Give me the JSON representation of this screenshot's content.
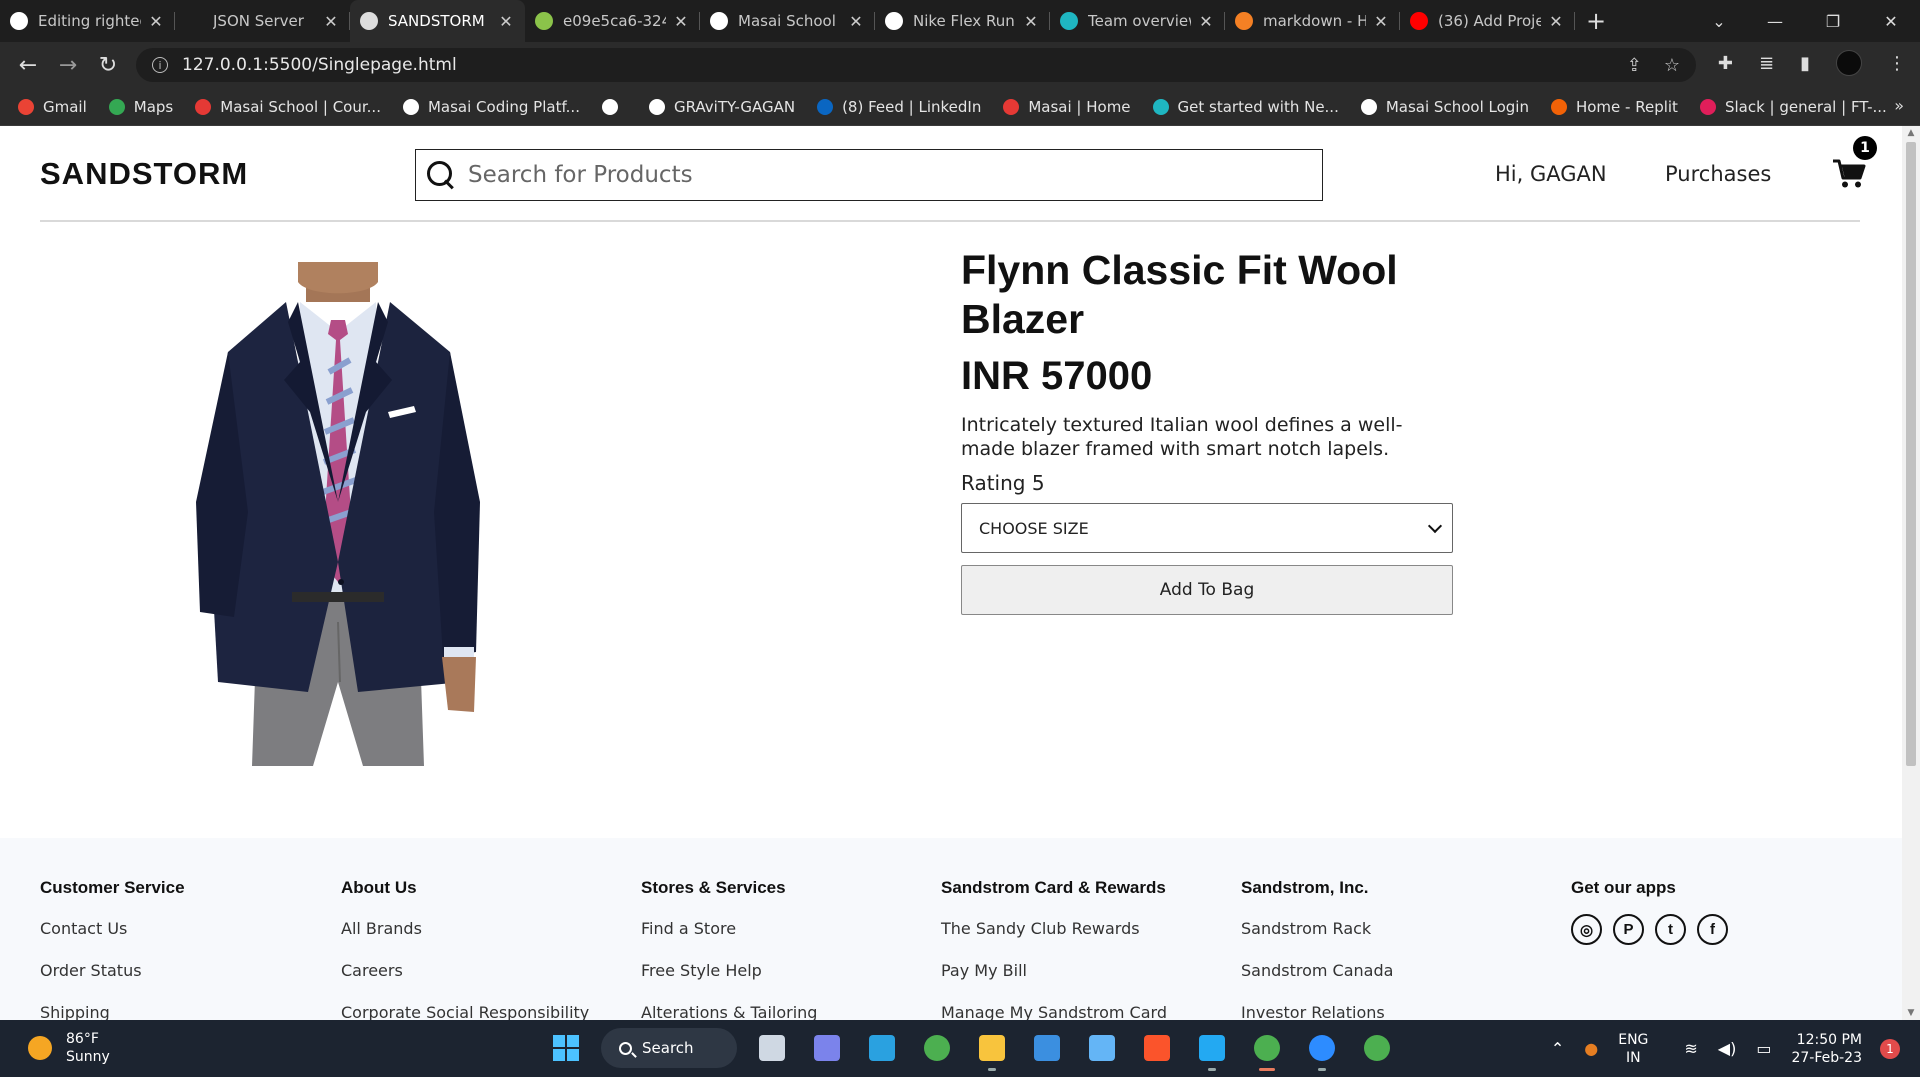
{
  "browser": {
    "tabs": [
      {
        "title": "Editing righted",
        "favicon": "github-icon",
        "fav_color": "#ffffff",
        "active": false
      },
      {
        "title": "JSON Server",
        "favicon": "blank-icon",
        "fav_color": "#1e1e1e",
        "active": false
      },
      {
        "title": "SANDSTORM",
        "favicon": "sandstorm-icon",
        "fav_color": "#dddddd",
        "active": true
      },
      {
        "title": "e09e5ca6-324",
        "favicon": "leaf-icon",
        "fav_color": "#8bc34a",
        "active": false
      },
      {
        "title": "Masai School |",
        "favicon": "globe-icon",
        "fav_color": "#ffffff",
        "active": false
      },
      {
        "title": "Nike Flex Runn",
        "favicon": "notion-icon",
        "fav_color": "#ffffff",
        "active": false
      },
      {
        "title": "Team overview",
        "favicon": "diamond-icon",
        "fav_color": "#1fb6c1",
        "active": false
      },
      {
        "title": "markdown - H",
        "favicon": "stack-icon",
        "fav_color": "#f48024",
        "active": false
      },
      {
        "title": "(36) Add Proje",
        "favicon": "youtube-icon",
        "fav_color": "#ff0000",
        "active": false
      }
    ],
    "new_tab": "+",
    "url": "127.0.0.1:5500/Singlepage.html",
    "bookmarks": [
      {
        "label": "Gmail",
        "icon": "gmail-icon",
        "color": "#ea4335"
      },
      {
        "label": "Maps",
        "icon": "maps-icon",
        "color": "#34a853"
      },
      {
        "label": "Masai School | Cour...",
        "icon": "masai-icon",
        "color": "#e53935"
      },
      {
        "label": "Masai Coding Platf...",
        "icon": "masai-m-icon",
        "color": "#ffffff"
      },
      {
        "label": "",
        "icon": "globe-icon",
        "color": "#ffffff"
      },
      {
        "label": "GRAviTY-GAGAN",
        "icon": "github-icon",
        "color": "#ffffff"
      },
      {
        "label": "(8) Feed | LinkedIn",
        "icon": "linkedin-icon",
        "color": "#0a66c2"
      },
      {
        "label": "Masai | Home",
        "icon": "masai-icon",
        "color": "#e53935"
      },
      {
        "label": "Get started with Ne...",
        "icon": "diamond-icon",
        "color": "#1fb6c1"
      },
      {
        "label": "Masai School Login",
        "icon": "masai-m-icon",
        "color": "#ffffff"
      },
      {
        "label": "Home - Replit",
        "icon": "replit-icon",
        "color": "#f26207"
      },
      {
        "label": "Slack | general | FT-...",
        "icon": "slack-icon",
        "color": "#e01e5a"
      }
    ],
    "bookmarks_more": "»"
  },
  "site": {
    "logo": "SANDSTORM",
    "search_placeholder": "Search for Products",
    "greeting": "Hi, GAGAN",
    "purchases": "Purchases",
    "cart_count": "1"
  },
  "product": {
    "title": "Flynn Classic Fit Wool Blazer",
    "price": "INR 57000",
    "description": "Intricately textured Italian wool defines a well-made blazer framed with smart notch lapels.",
    "rating": "Rating 5",
    "size_select": "CHOOSE SIZE",
    "add_button": "Add To Bag",
    "image_alt": "navy-wool-blazer-image"
  },
  "footer": {
    "columns": [
      {
        "heading": "Customer Service",
        "links": [
          "Contact Us",
          "Order Status",
          "Shipping"
        ]
      },
      {
        "heading": "About Us",
        "links": [
          "All Brands",
          "Careers",
          "Corporate Social Responsibility"
        ]
      },
      {
        "heading": "Stores & Services",
        "links": [
          "Find a Store",
          "Free Style Help",
          "Alterations & Tailoring"
        ]
      },
      {
        "heading": "Sandstrom Card & Rewards",
        "links": [
          "The Sandy Club Rewards",
          "Pay My Bill",
          "Manage My Sandstrom Card"
        ]
      },
      {
        "heading": "Sandstrom, Inc.",
        "links": [
          "Sandstrom Rack",
          "Sandstrom Canada",
          "Investor Relations"
        ]
      }
    ],
    "apps_heading": "Get our apps",
    "apps": [
      {
        "icon": "instagram-icon",
        "glyph": "◎"
      },
      {
        "icon": "pinterest-icon",
        "glyph": "P"
      },
      {
        "icon": "twitter-icon",
        "glyph": "t"
      },
      {
        "icon": "facebook-icon",
        "glyph": "f"
      }
    ]
  },
  "taskbar": {
    "temperature": "86°F",
    "condition": "Sunny",
    "search_label": "Search",
    "apps": [
      {
        "name": "task-view-icon",
        "color": "#cfd8e3",
        "running": false
      },
      {
        "name": "teams-icon",
        "color": "#7b83eb",
        "running": false
      },
      {
        "name": "desktop-icon",
        "color": "#2aa1e0",
        "running": false
      },
      {
        "name": "chrome-icon",
        "color": "#4caf50",
        "running": false
      },
      {
        "name": "file-explorer-icon",
        "color": "#f8c43d",
        "running": true
      },
      {
        "name": "store-icon",
        "color": "#3b8fe0",
        "running": false
      },
      {
        "name": "keyboard-icon",
        "color": "#64b5f6",
        "running": false
      },
      {
        "name": "brave-icon",
        "color": "#fb542b",
        "running": false
      },
      {
        "name": "vscode-icon",
        "color": "#23a9f2",
        "running": true
      },
      {
        "name": "chrome-profile-icon",
        "color": "#4caf50",
        "running": true,
        "active": true
      },
      {
        "name": "zoom-icon",
        "color": "#2d8cff",
        "running": true
      },
      {
        "name": "chrome-alt-icon",
        "color": "#4caf50",
        "running": false
      }
    ],
    "lang_top": "ENG",
    "lang_bottom": "IN",
    "time": "12:50 PM",
    "date": "27-Feb-23",
    "notifications": "1"
  }
}
